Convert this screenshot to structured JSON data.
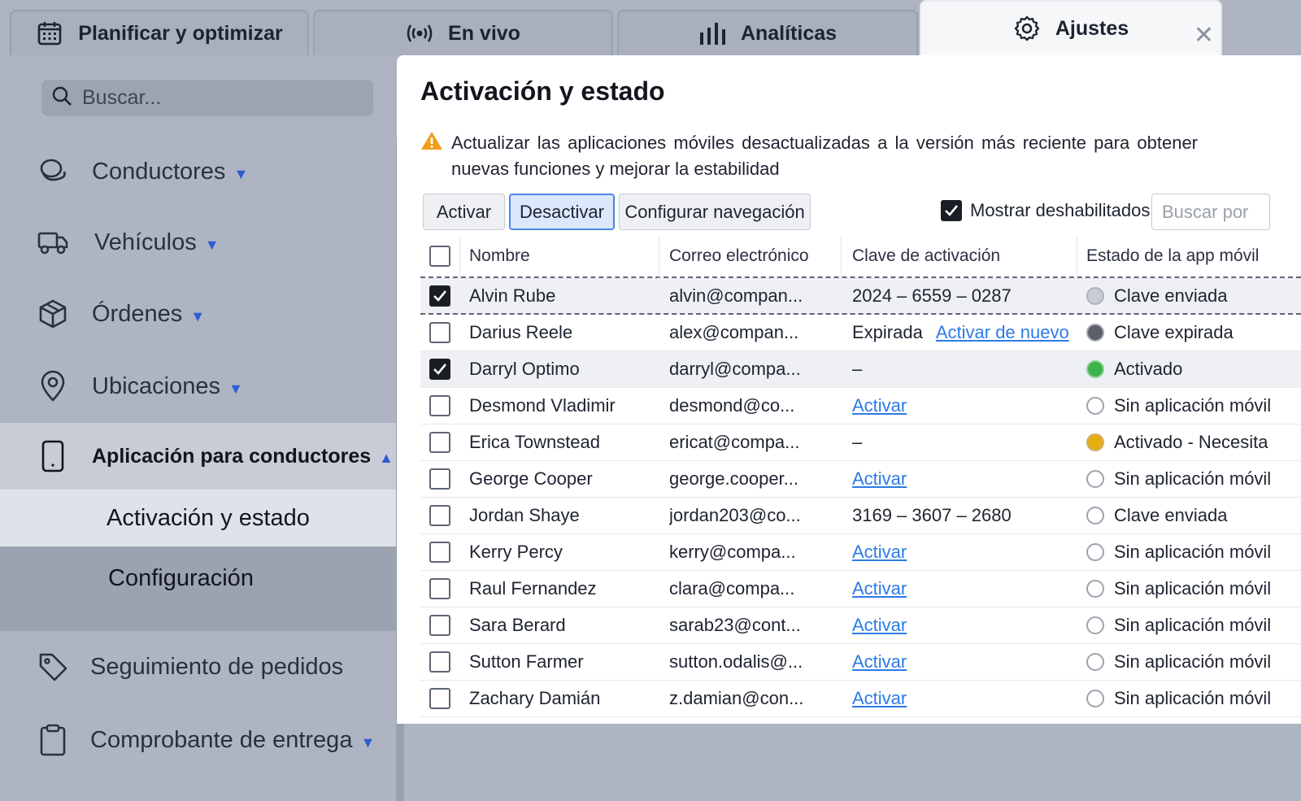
{
  "tabs": [
    {
      "label": "Planificar y optimizar",
      "icon": "calendar-icon"
    },
    {
      "label": "En vivo",
      "icon": "broadcast-icon"
    },
    {
      "label": "Analíticas",
      "icon": "bar-chart-icon"
    },
    {
      "label": "Ajustes",
      "icon": "gear-icon",
      "active": true
    }
  ],
  "sidebar": {
    "search_placeholder": "Buscar...",
    "items": [
      {
        "label": "Conductores",
        "icon": "drivers-icon",
        "caret": "▼"
      },
      {
        "label": "Vehículos",
        "icon": "truck-icon",
        "caret": "▼"
      },
      {
        "label": "Órdenes",
        "icon": "box-icon",
        "caret": "▼"
      },
      {
        "label": "Ubicaciones",
        "icon": "location-pin-icon",
        "caret": "▼"
      },
      {
        "label": "Aplicación para conductores",
        "icon": "phone-icon",
        "caret": "▲"
      },
      {
        "label": "Seguimiento de pedidos",
        "icon": "tag-icon",
        "caret": ""
      },
      {
        "label": "Comprobante de entrega",
        "icon": "clipboard-icon",
        "caret": "▼"
      }
    ],
    "sub_items": [
      {
        "label": "Activación y estado",
        "selected": true
      },
      {
        "label": "Configuración"
      }
    ]
  },
  "main": {
    "title": "Activación y estado",
    "warning": "Actualizar las aplicaciones móviles desactualizadas a la versión más reciente para obtener nuevas funciones y mejorar la estabilidad",
    "toolbar": {
      "activate": "Activar",
      "deactivate": "Desactivar",
      "configure": "Configurar navegación",
      "show_disabled": "Mostrar deshabilitados",
      "search_placeholder": "Buscar por"
    },
    "table": {
      "columns": [
        "Nombre",
        "Correo electrónico",
        "Clave de activación",
        "Estado de la app móvil"
      ],
      "rows": [
        {
          "checked": true,
          "name": "Alvin Rube",
          "email": "alvin@compan...",
          "key": "2024 – 6559 – 0287",
          "key_link": "",
          "status": "Clave enviada",
          "status_color": "grey"
        },
        {
          "checked": false,
          "name": "Darius Reele",
          "email": "alex@compan...",
          "key": "Expirada",
          "key_link": "Activar de nuevo",
          "status": "Clave expirada",
          "status_color": "dark"
        },
        {
          "checked": true,
          "name": "Darryl Optimo",
          "email": "darryl@compa...",
          "key": "–",
          "key_link": "",
          "status": "Activado",
          "status_color": "green"
        },
        {
          "checked": false,
          "name": "Desmond Vladimir",
          "email": "desmond@co...",
          "key": "",
          "key_link": "Activar",
          "status": "Sin aplicación móvil",
          "status_color": "empty"
        },
        {
          "checked": false,
          "name": "Erica Townstead",
          "email": "ericat@compa...",
          "key": "–",
          "key_link": "",
          "status": "Activado - Necesita",
          "status_color": "amber"
        },
        {
          "checked": false,
          "name": "George Cooper",
          "email": "george.cooper...",
          "key": "",
          "key_link": "Activar",
          "status": "Sin aplicación móvil",
          "status_color": "empty"
        },
        {
          "checked": false,
          "name": "Jordan Shaye",
          "email": "jordan203@co...",
          "key": "3169 – 3607 – 2680",
          "key_link": "",
          "status": "Clave enviada",
          "status_color": "empty"
        },
        {
          "checked": false,
          "name": "Kerry Percy",
          "email": "kerry@compa...",
          "key": "",
          "key_link": "Activar",
          "status": "Sin aplicación móvil",
          "status_color": "empty"
        },
        {
          "checked": false,
          "name": "Raul Fernandez",
          "email": "clara@compa...",
          "key": "",
          "key_link": "Activar",
          "status": "Sin aplicación móvil",
          "status_color": "empty"
        },
        {
          "checked": false,
          "name": "Sara Berard",
          "email": "sarab23@cont...",
          "key": "",
          "key_link": "Activar",
          "status": "Sin aplicación móvil",
          "status_color": "empty"
        },
        {
          "checked": false,
          "name": "Sutton Farmer",
          "email": "sutton.odalis@...",
          "key": "",
          "key_link": "Activar",
          "status": "Sin aplicación móvil",
          "status_color": "empty"
        },
        {
          "checked": false,
          "name": "Zachary Damián",
          "email": "z.damian@con...",
          "key": "",
          "key_link": "Activar",
          "status": "Sin aplicación móvil",
          "status_color": "empty"
        }
      ]
    }
  },
  "colors": {
    "accent": "#2f5bd3",
    "link": "#2c7be5",
    "warning": "#f29b1d"
  }
}
